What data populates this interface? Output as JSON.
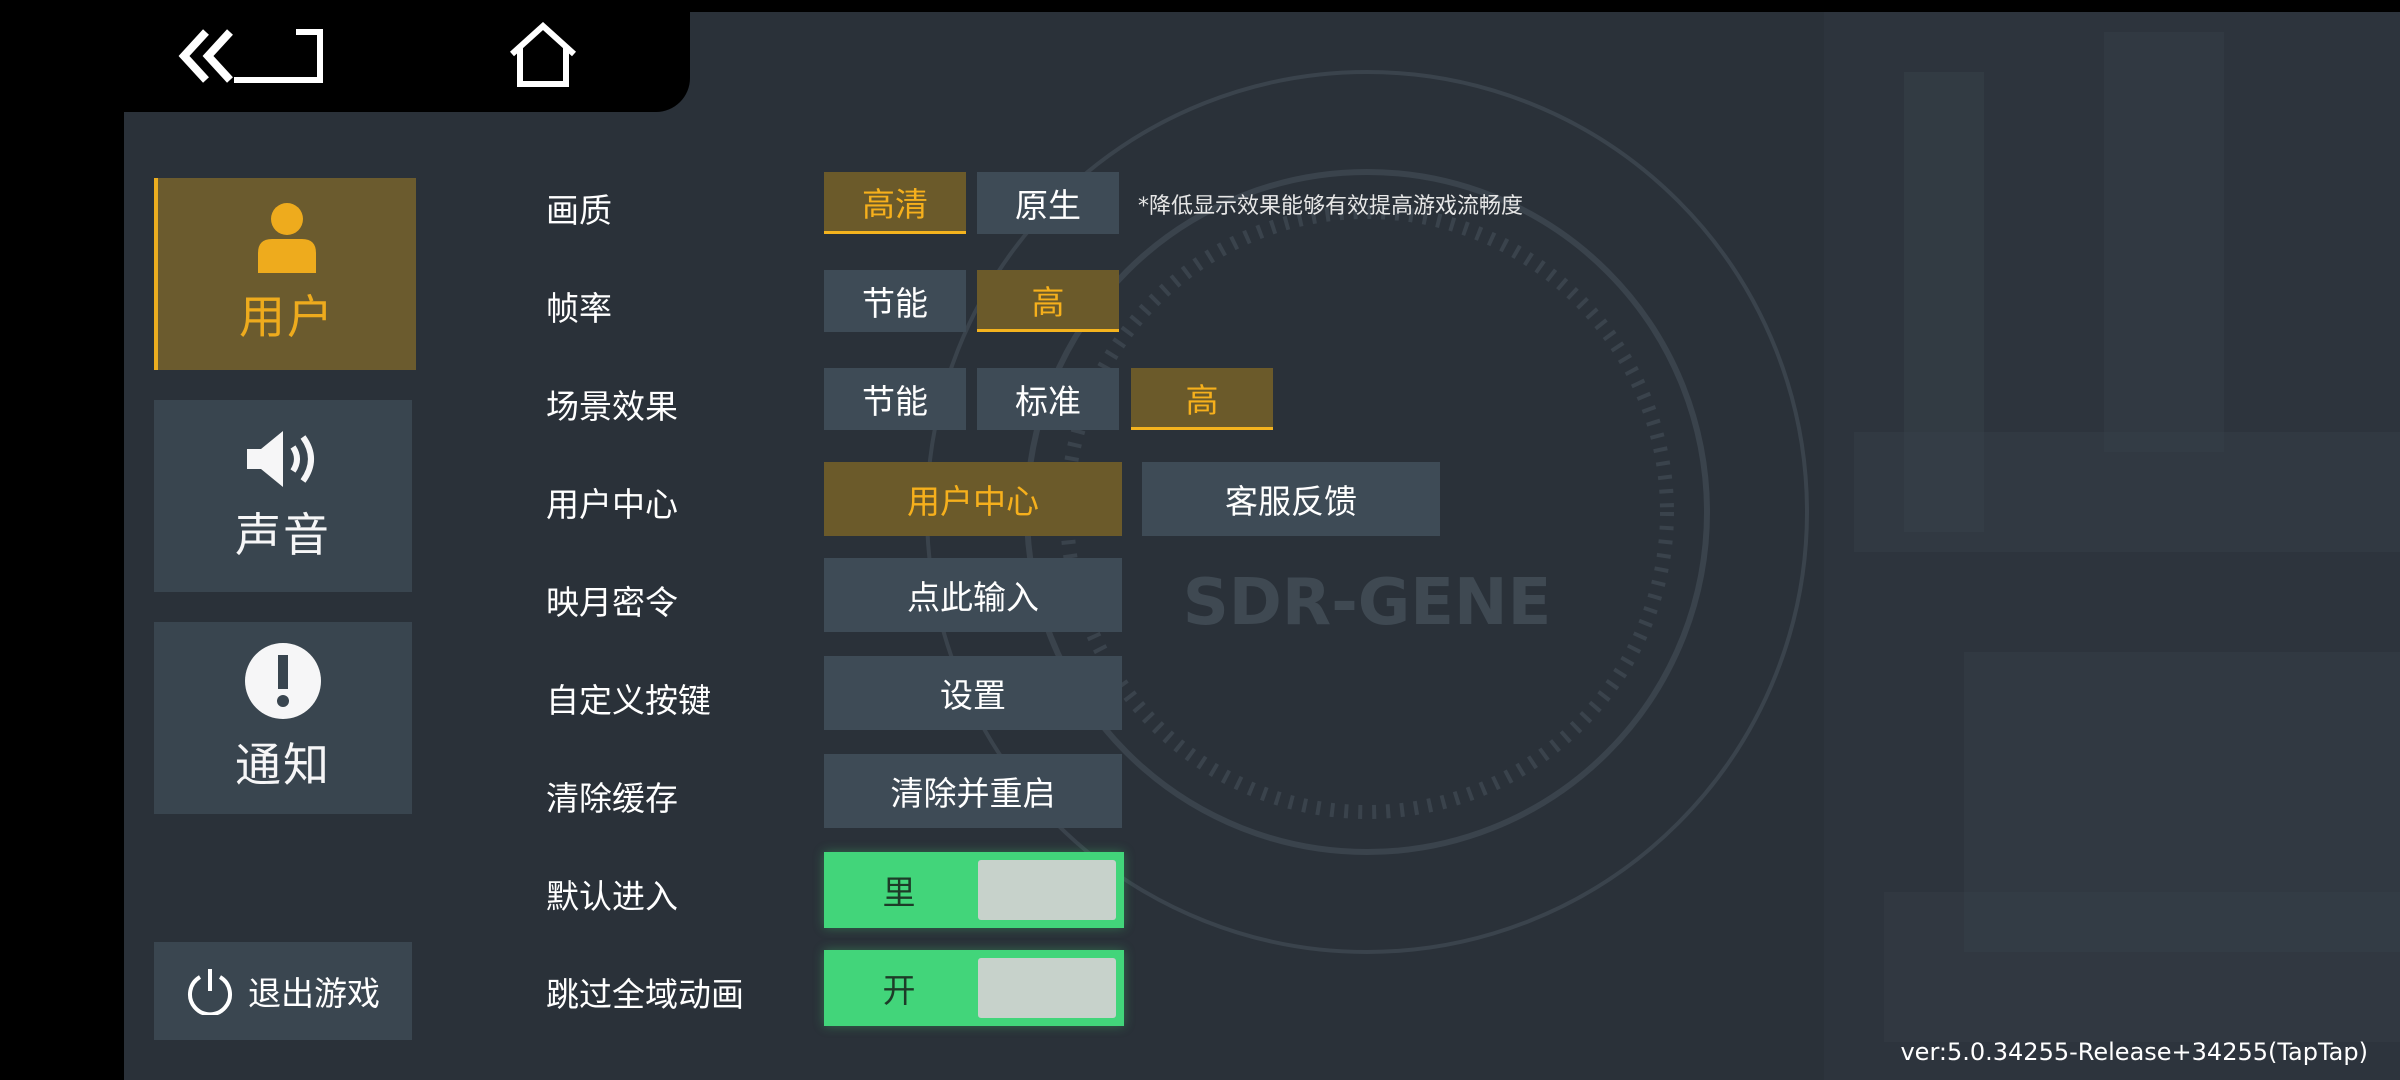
{
  "header": {
    "back_icon": "back-double-chevron-icon",
    "home_icon": "home-icon"
  },
  "sidebar": {
    "tabs": [
      {
        "label": "用户",
        "icon": "user-icon",
        "active": true
      },
      {
        "label": "声音",
        "icon": "speaker-icon",
        "active": false
      },
      {
        "label": "通知",
        "icon": "alert-icon",
        "active": false
      }
    ],
    "exit": {
      "label": "退出游戏",
      "icon": "power-icon"
    }
  },
  "settings": {
    "quality": {
      "label": "画质",
      "options": [
        "高清",
        "原生"
      ],
      "selected": "高清",
      "note": "*降低显示效果能够有效提高游戏流畅度"
    },
    "framerate": {
      "label": "帧率",
      "options": [
        "节能",
        "高"
      ],
      "selected": "高"
    },
    "scene": {
      "label": "场景效果",
      "options": [
        "节能",
        "标准",
        "高"
      ],
      "selected": "高"
    },
    "user_center": {
      "label": "用户中心",
      "primary": "用户中心",
      "secondary": "客服反馈"
    },
    "password": {
      "label": "映月密令",
      "button": "点此输入"
    },
    "keys": {
      "label": "自定义按键",
      "button": "设置"
    },
    "cache": {
      "label": "清除缓存",
      "button": "清除并重启"
    },
    "default_entry": {
      "label": "默认进入",
      "value": "里"
    },
    "skip_anim": {
      "label": "跳过全域动画",
      "value": "开"
    }
  },
  "background": {
    "logo_text": "SDR-GENE"
  },
  "version": "ver:5.0.34255-Release+34255(TapTap)",
  "colors": {
    "accent": "#f4b31e",
    "panel": "#2a3139",
    "button": "#3e4b56",
    "toggle": "#42d57a"
  }
}
